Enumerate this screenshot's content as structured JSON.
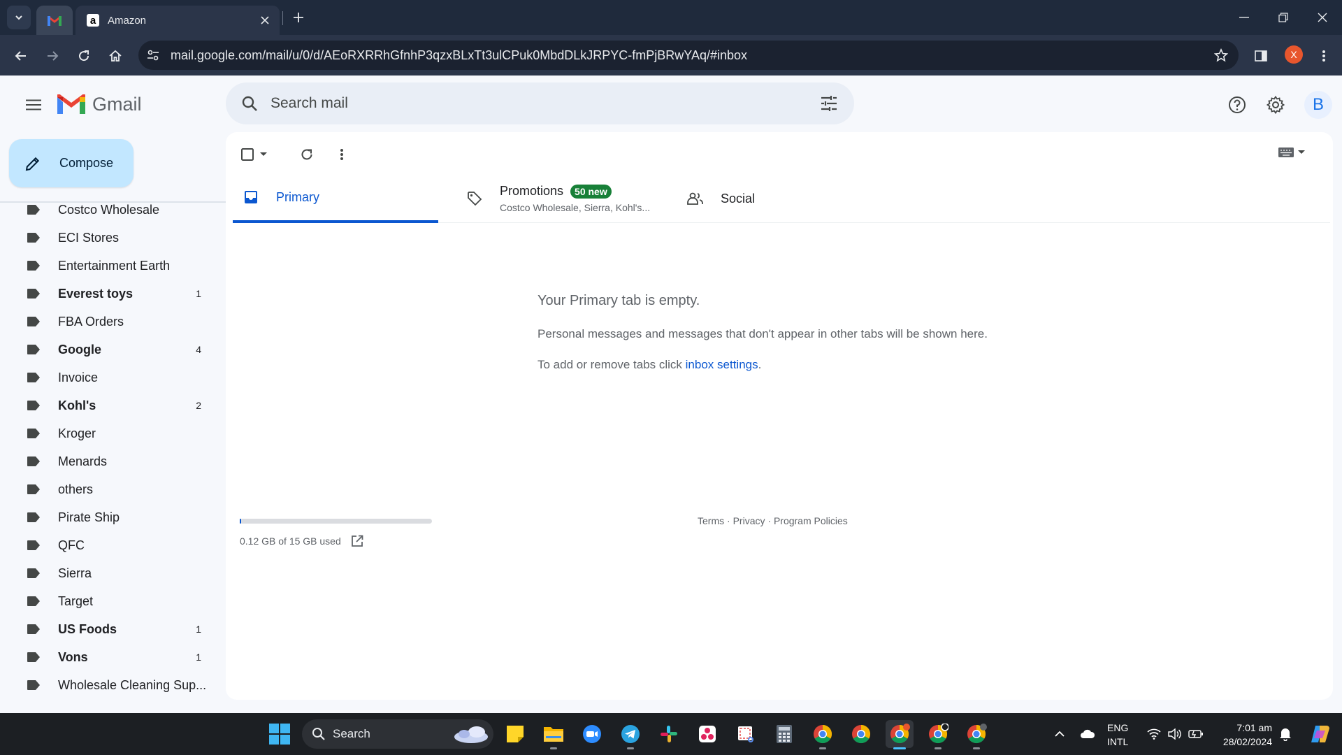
{
  "browser": {
    "active_tab_title": "Amazon",
    "url": "mail.google.com/mail/u/0/d/AEoRXRRhGfnhP3qzxBLxTt3ulCPuk0MbdDLkJRPYC-fmPjBRwYAq/#inbox",
    "profile_initial": "X"
  },
  "header": {
    "app_name": "Gmail",
    "search_placeholder": "Search mail",
    "avatar_initial": "B"
  },
  "sidebar": {
    "compose_label": "Compose",
    "labels": [
      {
        "name": "Costco Wholesale",
        "count": "",
        "bold": false
      },
      {
        "name": "ECI Stores",
        "count": "",
        "bold": false
      },
      {
        "name": "Entertainment Earth",
        "count": "",
        "bold": false
      },
      {
        "name": "Everest toys",
        "count": "1",
        "bold": true
      },
      {
        "name": "FBA Orders",
        "count": "",
        "bold": false
      },
      {
        "name": "Google",
        "count": "4",
        "bold": true
      },
      {
        "name": "Invoice",
        "count": "",
        "bold": false
      },
      {
        "name": "Kohl's",
        "count": "2",
        "bold": true
      },
      {
        "name": "Kroger",
        "count": "",
        "bold": false
      },
      {
        "name": "Menards",
        "count": "",
        "bold": false
      },
      {
        "name": "others",
        "count": "",
        "bold": false
      },
      {
        "name": "Pirate Ship",
        "count": "",
        "bold": false
      },
      {
        "name": "QFC",
        "count": "",
        "bold": false
      },
      {
        "name": "Sierra",
        "count": "",
        "bold": false
      },
      {
        "name": "Target",
        "count": "",
        "bold": false
      },
      {
        "name": "US Foods",
        "count": "1",
        "bold": true
      },
      {
        "name": "Vons",
        "count": "1",
        "bold": true
      },
      {
        "name": "Wholesale Cleaning Sup...",
        "count": "",
        "bold": false
      }
    ]
  },
  "tabs": {
    "primary": "Primary",
    "promotions": "Promotions",
    "promotions_badge": "50 new",
    "promotions_senders": "Costco Wholesale, Sierra, Kohl's...",
    "social": "Social"
  },
  "empty_state": {
    "title": "Your Primary tab is empty.",
    "line1": "Personal messages and messages that don't appear in other tabs will be shown here.",
    "line2_prefix": "To add or remove tabs click ",
    "line2_link": "inbox settings",
    "line2_suffix": "."
  },
  "footer": {
    "storage_text": "0.12 GB of 15 GB used",
    "storage_fraction": 0.008,
    "terms": "Terms",
    "privacy": "Privacy",
    "policies": "Program Policies",
    "separator": " · "
  },
  "taskbar": {
    "search_label": "Search",
    "lang_top": "ENG",
    "lang_bottom": "INTL",
    "time": "7:01 am",
    "date": "28/02/2024"
  },
  "colors": {
    "accent": "#0b57d0",
    "compose_bg": "#c2e7ff",
    "badge_green": "#188038",
    "chrome_dark": "#1f2a3c"
  }
}
